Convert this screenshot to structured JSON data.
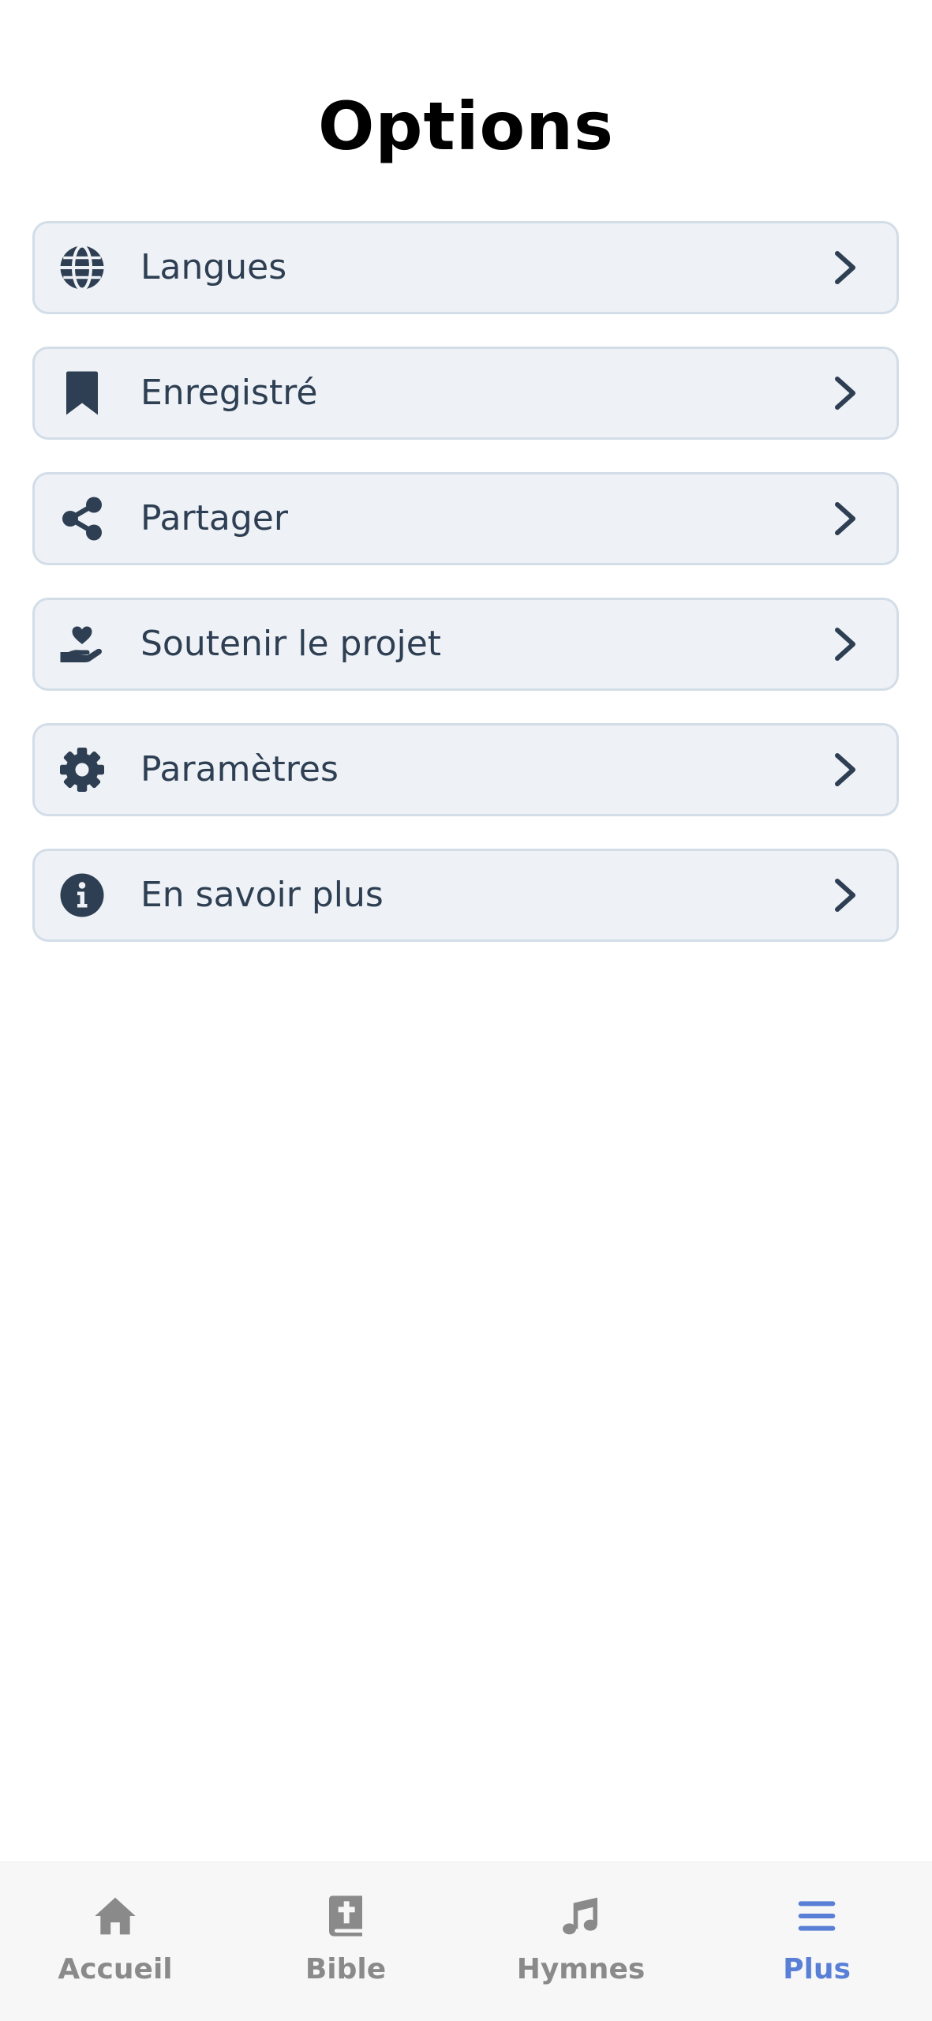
{
  "page": {
    "title": "Options"
  },
  "menu": {
    "items": [
      {
        "label": "Langues",
        "icon": "globe-icon"
      },
      {
        "label": "Enregistré",
        "icon": "bookmark-icon"
      },
      {
        "label": "Partager",
        "icon": "share-icon"
      },
      {
        "label": "Soutenir le projet",
        "icon": "hand-heart-icon"
      },
      {
        "label": "Paramètres",
        "icon": "gear-icon"
      },
      {
        "label": "En savoir plus",
        "icon": "info-icon"
      }
    ]
  },
  "bottom_nav": {
    "items": [
      {
        "label": "Accueil",
        "icon": "home-icon",
        "active": false
      },
      {
        "label": "Bible",
        "icon": "bible-icon",
        "active": false
      },
      {
        "label": "Hymnes",
        "icon": "music-note-icon",
        "active": false
      },
      {
        "label": "Plus",
        "icon": "menu-icon",
        "active": true
      }
    ]
  },
  "colors": {
    "item_background": "#eef2f6",
    "item_border": "#d3dde7",
    "item_text": "#2e3f53",
    "nav_inactive": "#8a8a8a",
    "nav_active": "#5a7fd6"
  }
}
